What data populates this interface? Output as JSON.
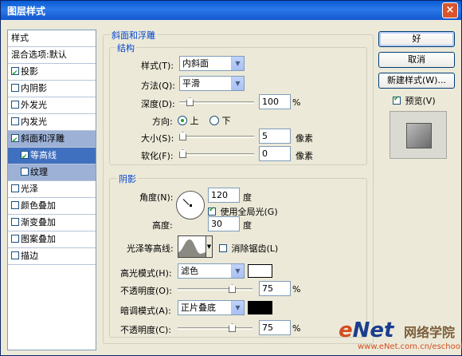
{
  "window": {
    "title": "图层样式",
    "close": "×"
  },
  "stylelist": {
    "header": "样式",
    "items": [
      {
        "label": "混合选项:默认",
        "checkbox": false,
        "checked": false,
        "state": "normal"
      },
      {
        "label": "投影",
        "checkbox": true,
        "checked": true,
        "state": "normal"
      },
      {
        "label": "内阴影",
        "checkbox": true,
        "checked": false,
        "state": "normal"
      },
      {
        "label": "外发光",
        "checkbox": true,
        "checked": false,
        "state": "normal"
      },
      {
        "label": "内发光",
        "checkbox": true,
        "checked": false,
        "state": "normal"
      },
      {
        "label": "斜面和浮雕",
        "checkbox": true,
        "checked": true,
        "state": "selected"
      },
      {
        "label": "等高线",
        "checkbox": true,
        "checked": true,
        "state": "subselected"
      },
      {
        "label": "纹理",
        "checkbox": true,
        "checked": false,
        "state": "subitem"
      },
      {
        "label": "光泽",
        "checkbox": true,
        "checked": false,
        "state": "normal"
      },
      {
        "label": "颜色叠加",
        "checkbox": true,
        "checked": false,
        "state": "normal"
      },
      {
        "label": "渐变叠加",
        "checkbox": true,
        "checked": false,
        "state": "normal"
      },
      {
        "label": "图案叠加",
        "checkbox": true,
        "checked": false,
        "state": "normal"
      },
      {
        "label": "描边",
        "checkbox": true,
        "checked": false,
        "state": "normal"
      }
    ]
  },
  "bevel": {
    "title": "斜面和浮雕",
    "structure": {
      "title": "结构",
      "style_label": "样式(T):",
      "style_value": "内斜面",
      "technique_label": "方法(Q):",
      "technique_value": "平滑",
      "depth_label": "深度(D):",
      "depth_value": "100",
      "depth_unit": "%",
      "depth_level": 0.1,
      "direction_label": "方向:",
      "direction_up": "上",
      "direction_down": "下",
      "size_label": "大小(S):",
      "size_value": "5",
      "size_unit": "像素",
      "size_level": 0.0,
      "soften_label": "软化(F):",
      "soften_value": "0",
      "soften_unit": "像素",
      "soften_level": 0.0
    },
    "shading": {
      "title": "阴影",
      "angle_label": "角度(N):",
      "angle_value": "120",
      "angle_unit": "度",
      "global_light_label": "使用全局光(G)",
      "global_light_checked": true,
      "altitude_label": "高度:",
      "altitude_value": "30",
      "altitude_unit": "度",
      "gloss_label": "光泽等高线:",
      "antialias_label": "消除锯齿(L)",
      "antialias_checked": false,
      "highlight_mode_label": "高光模式(H):",
      "highlight_mode_value": "滤色",
      "highlight_color": "#FFFFFF",
      "highlight_opacity_label": "不透明度(O):",
      "highlight_opacity_value": "75",
      "highlight_opacity_unit": "%",
      "highlight_opacity_level": 0.75,
      "shadow_mode_label": "暗调模式(A):",
      "shadow_mode_value": "正片叠底",
      "shadow_color": "#000000",
      "shadow_opacity_label": "不透明度(C):",
      "shadow_opacity_value": "75",
      "shadow_opacity_unit": "%",
      "shadow_opacity_level": 0.75
    }
  },
  "buttons": {
    "ok": "好",
    "cancel": "取消",
    "new_style": "新建样式(W)...",
    "preview_label": "预览(V)",
    "preview_checked": true
  },
  "watermark": {
    "brand": "eNet",
    "cn": "网络学院",
    "url": "www.eNet.com.cn/eschool"
  }
}
